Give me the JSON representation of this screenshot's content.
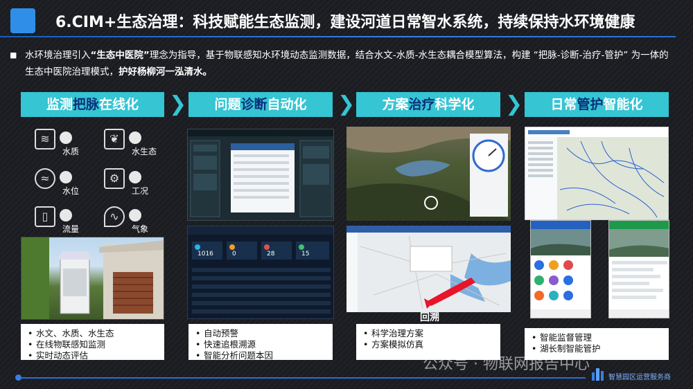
{
  "title": "6.CIM+生态治理：科技赋能生态监测，建设河道日常智水系统，持续保持水环境健康",
  "intro": {
    "p1": "水环境治理引入",
    "p1b": "“生态中医院”",
    "p2": "理念为指导，基于物联感知水环境动态监测数据，结合水文-水质-水生态耦合模型算法，构建 “把脉-诊断-治疗-管护” 为一体的生态中医院治理模式，",
    "p2b": "护好杨柳河一泓清水。"
  },
  "columns": [
    {
      "pre": "监测",
      "hl": "把脉",
      "post": "在线化"
    },
    {
      "pre": "问题",
      "hl": "诊断",
      "post": "自动化"
    },
    {
      "pre": "方案",
      "hl": "治疗",
      "post": "科学化"
    },
    {
      "pre": "日常",
      "hl": "管护",
      "post": "智能化"
    }
  ],
  "sensors": [
    {
      "label": "水质",
      "icon": "water-quality-icon"
    },
    {
      "label": "水生态",
      "icon": "fish-icon"
    },
    {
      "label": "水位",
      "icon": "water-level-icon"
    },
    {
      "label": "工况",
      "icon": "gear-machine-icon"
    },
    {
      "label": "流量",
      "icon": "flow-pipe-icon"
    },
    {
      "label": "气象",
      "icon": "weather-drop-icon"
    }
  ],
  "lists": [
    [
      "水文、水质、水生态",
      "在线物联感知监测",
      "实时动态评估"
    ],
    [
      "自动预警",
      "快速追根溯源",
      "智能分析问题本因"
    ],
    [
      "科学治理方案",
      "方案模拟仿真"
    ],
    [
      "智能监督管理",
      "湖长制智能管护"
    ]
  ],
  "dash_stats": [
    "1016",
    "0",
    "28",
    "15"
  ],
  "map_caption": "回溯",
  "watermark": "公众号 · 物联网报告中心",
  "brand": "智慧园区运营服务商",
  "colors": {
    "accent": "#35c5d3",
    "highlight": "#0c2f7a",
    "title_block": "#2f8fe8"
  }
}
